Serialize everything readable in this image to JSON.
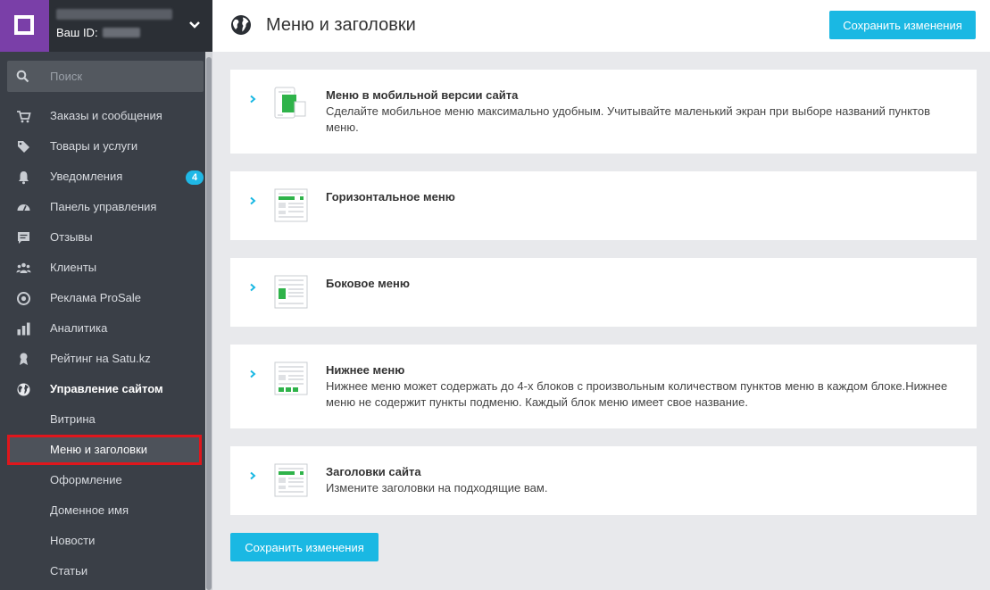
{
  "sidebar": {
    "user_id_label": "Ваш ID:",
    "search_placeholder": "Поиск",
    "items": [
      {
        "label": "Заказы и сообщения",
        "icon": "cart-icon"
      },
      {
        "label": "Товары и услуги",
        "icon": "tag-icon"
      },
      {
        "label": "Уведомления",
        "icon": "bell-icon",
        "badge": "4"
      },
      {
        "label": "Панель управления",
        "icon": "gauge-icon"
      },
      {
        "label": "Отзывы",
        "icon": "comment-icon"
      },
      {
        "label": "Клиенты",
        "icon": "people-icon"
      },
      {
        "label": "Реклама ProSale",
        "icon": "target-icon"
      },
      {
        "label": "Аналитика",
        "icon": "bar-chart-icon"
      },
      {
        "label": "Рейтинг на Satu.kz",
        "icon": "award-icon"
      },
      {
        "label": "Управление сайтом",
        "icon": "globe-icon"
      }
    ],
    "subitems": [
      {
        "label": "Витрина"
      },
      {
        "label": "Меню и заголовки"
      },
      {
        "label": "Оформление"
      },
      {
        "label": "Доменное имя"
      },
      {
        "label": "Новости"
      },
      {
        "label": "Статьи"
      }
    ]
  },
  "header": {
    "title": "Меню и заголовки",
    "save_label": "Сохранить изменения"
  },
  "cards": [
    {
      "title": "Меню в мобильной версии сайта",
      "desc": "Сделайте мобильное меню максимально удобным. Учитывайте маленький экран при выборе названий пунктов меню."
    },
    {
      "title": "Горизонтальное меню",
      "desc": ""
    },
    {
      "title": "Боковое меню",
      "desc": ""
    },
    {
      "title": "Нижнее меню",
      "desc": "Нижнее меню может содержать до 4-х блоков с произвольным количеством пунктов меню в каждом блоке.Нижнее меню не содержит пункты подменю. Каждый блок меню имеет свое название."
    },
    {
      "title": "Заголовки сайта",
      "desc": "Измените заголовки на подходящие вам."
    }
  ],
  "footer": {
    "save_label": "Сохранить изменения"
  },
  "colors": {
    "accent": "#1ab8e3",
    "brand": "#7a3fa8",
    "sidebar_bg": "#3a3f47",
    "thumb_green": "#2fb34a",
    "active_outline": "#e0161c"
  }
}
